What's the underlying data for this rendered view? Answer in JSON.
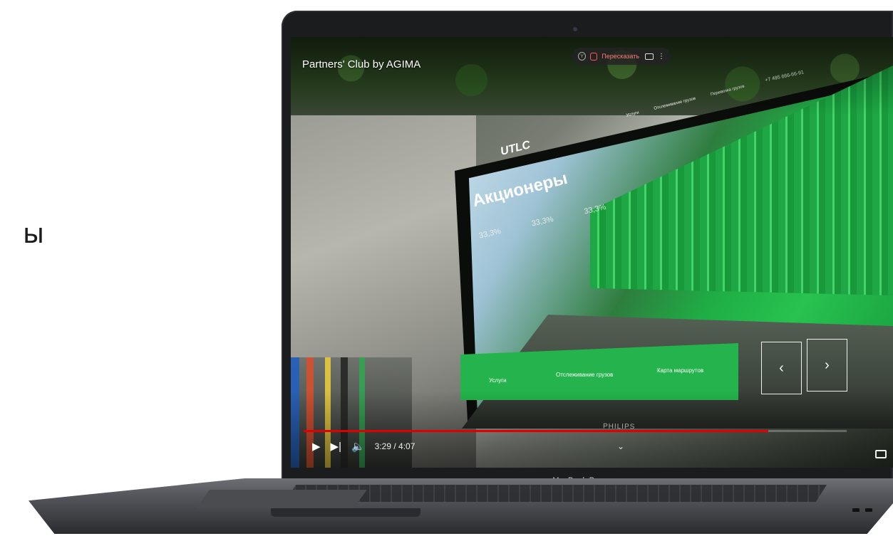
{
  "side_text": "ы",
  "video": {
    "title": "Partners' Club by AGIMA",
    "retell_label": "Пересказать",
    "time": "3:29 / 4:07",
    "progress_fraction": 0.855
  },
  "monitor": {
    "logo": "UTLC",
    "heading": "Акционеры",
    "stats": [
      "33,3%",
      "33,3%",
      "33,3%"
    ],
    "phone": "+7 495 666-66-91",
    "nav_items": [
      "Услуги",
      "Отслеживание грузов",
      "Перевозка грузов"
    ],
    "bottom_items": [
      "Услуги",
      "Отслеживание грузов",
      "Карта маршрутов"
    ],
    "brand": "PHILIPS"
  },
  "laptop_label": "MacBook Pro",
  "colors": {
    "progress": "#e00000",
    "accent_green": "#24b34c"
  }
}
